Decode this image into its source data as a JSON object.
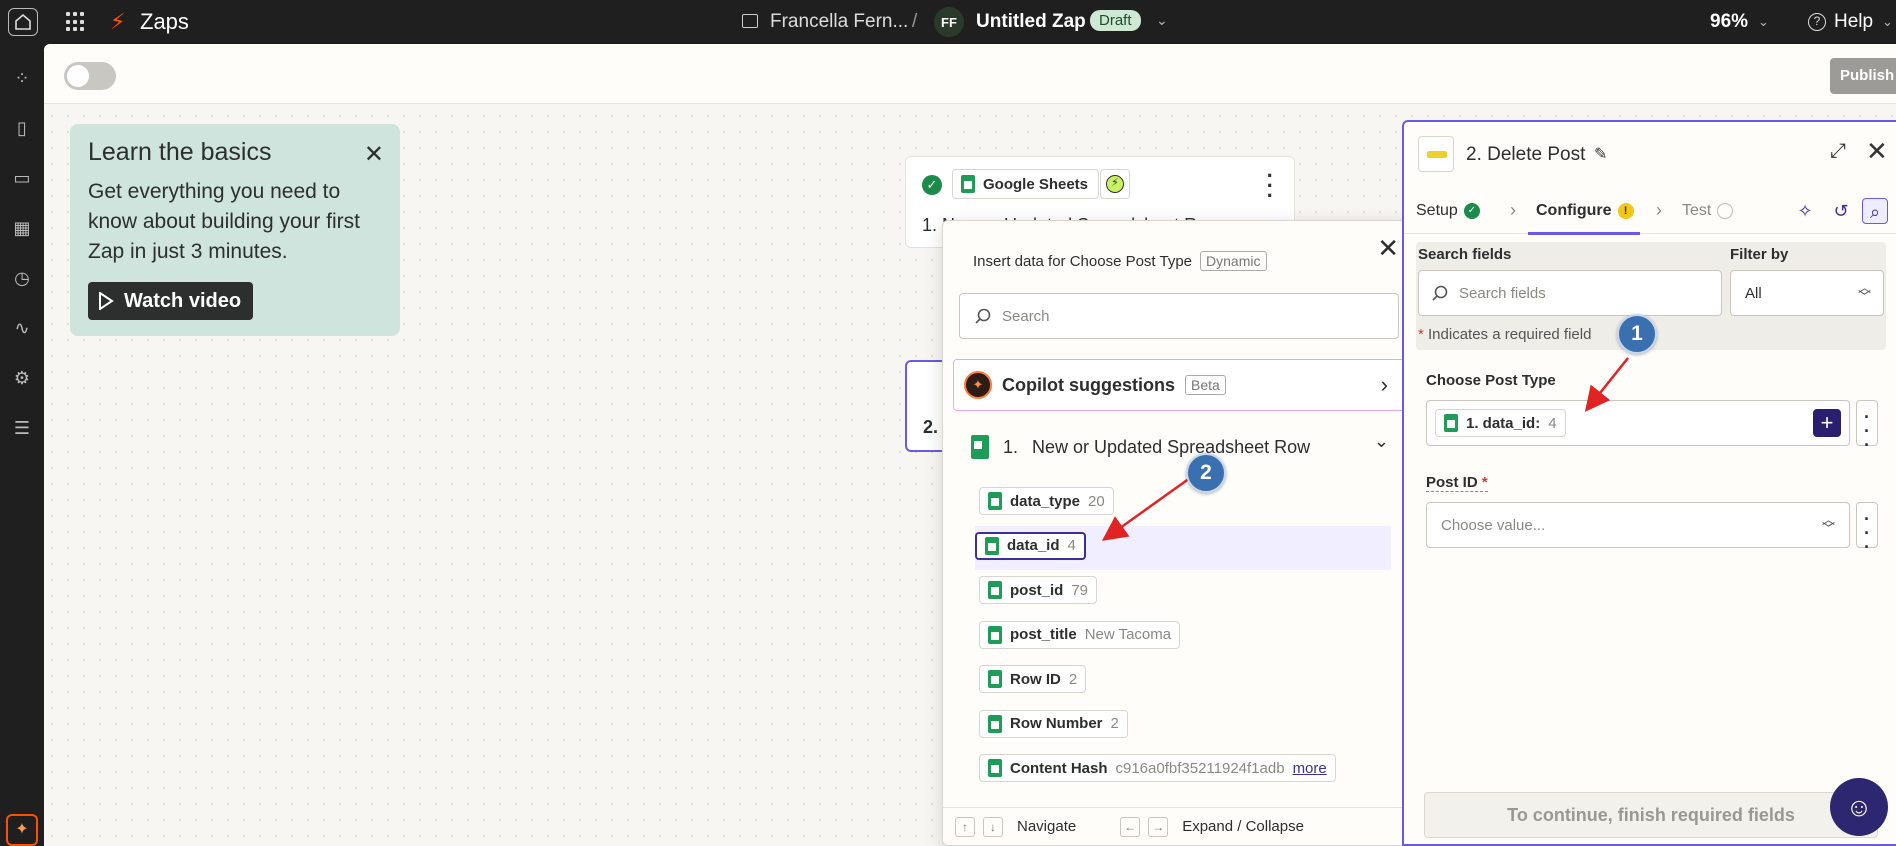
{
  "topbar": {
    "app_name": "Zaps",
    "folder_name": "Francella Fern...",
    "separator": "/",
    "avatar_initials": "FF",
    "zap_name": "Untitled Zap",
    "status": "Draft",
    "zoom": "96%",
    "help": "Help"
  },
  "canvas": {
    "publish_label": "Publish"
  },
  "learn": {
    "title": "Learn the basics",
    "body": "Get everything you need to know about building your first Zap in just 3 minutes.",
    "button": "Watch video"
  },
  "step1": {
    "app": "Google Sheets",
    "title": "1. New or Updated Spreadsheet Row"
  },
  "step2": {
    "title": "2."
  },
  "insert": {
    "header": "Insert data for Choose Post Type",
    "header_tag": "Dynamic",
    "search_placeholder": "Search",
    "copilot_label": "Copilot suggestions",
    "copilot_tag": "Beta",
    "section_number": "1.",
    "section_title": "New or Updated Spreadsheet Row",
    "fields": [
      {
        "key": "data_type",
        "value": "20"
      },
      {
        "key": "data_id",
        "value": "4"
      },
      {
        "key": "post_id",
        "value": "79"
      },
      {
        "key": "post_title",
        "value": "New Tacoma"
      },
      {
        "key": "Row ID",
        "value": "2"
      },
      {
        "key": "Row Number",
        "value": "2"
      },
      {
        "key": "Content Hash",
        "value": "c916a0fbf35211924f1adb",
        "more": "more"
      }
    ],
    "footer_navigate": "Navigate",
    "footer_expand": "Expand / Collapse"
  },
  "panel": {
    "title": "2. Delete Post",
    "tabs": [
      "Setup",
      "Configure",
      "Test"
    ],
    "search_fields_label": "Search fields",
    "search_fields_placeholder": "Search fields",
    "filter_label": "Filter by",
    "filter_value": "All",
    "required_note": "Indicates a required field",
    "required_star": "*",
    "choose_post_type_label": "Choose Post Type",
    "choose_post_type_pill_key": "1. data_id:",
    "choose_post_type_pill_value": "4",
    "post_id_label": "Post ID",
    "post_id_placeholder": "Choose value...",
    "continue_label": "To continue, finish required fields"
  },
  "annotations": {
    "badge1": "1",
    "badge2": "2",
    "arrow_color": "#e02424",
    "badge_color": "#3a6fb0"
  }
}
